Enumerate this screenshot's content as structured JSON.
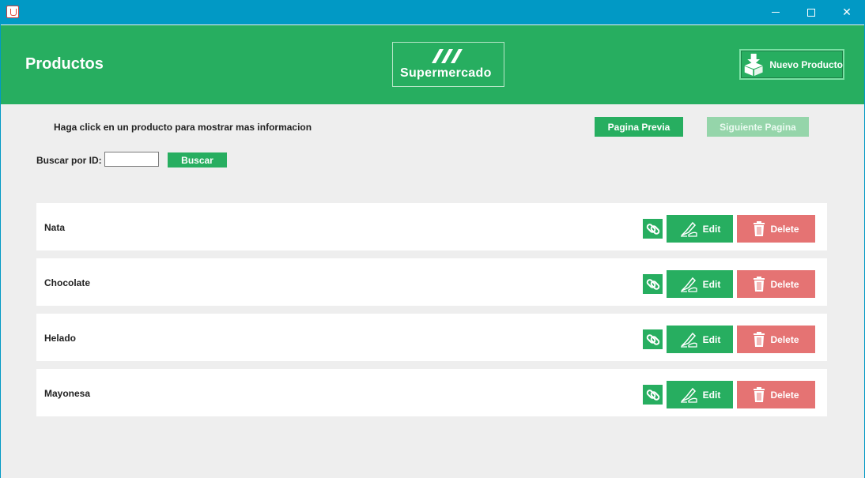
{
  "window": {
    "title": "",
    "icons": {
      "app": "java-cup-icon",
      "minimize": "minimize-icon",
      "maximize": "maximize-icon",
      "close": "close-icon"
    },
    "close_glyph": "✕"
  },
  "header": {
    "title": "Productos",
    "logo_text": "Supermercado",
    "new_product_label": "Nuevo Producto",
    "new_product_icon": "box-download-icon",
    "color": "#27ae60"
  },
  "controls": {
    "hint": "Haga click en un producto para mostrar mas informacion",
    "prev_page_label": "Pagina Previa",
    "next_page_label": "Siguiente Pagina",
    "next_page_enabled": false,
    "search_label": "Buscar por ID:",
    "search_value": "",
    "search_button_label": "Buscar"
  },
  "products": [
    {
      "name": "Nata",
      "edit_label": "Edit",
      "delete_label": "Delete"
    },
    {
      "name": "Chocolate",
      "edit_label": "Edit",
      "delete_label": "Delete"
    },
    {
      "name": "Helado",
      "edit_label": "Edit",
      "delete_label": "Delete"
    },
    {
      "name": "Mayonesa",
      "edit_label": "Edit",
      "delete_label": "Delete"
    }
  ],
  "row_icons": {
    "link": "link-icon",
    "edit": "pen-hand-icon",
    "delete": "trash-icon"
  },
  "colors": {
    "accent": "#27ae60",
    "delete": "#e57373",
    "disabled": "#95d5aa",
    "titlebar": "#0199c5"
  }
}
